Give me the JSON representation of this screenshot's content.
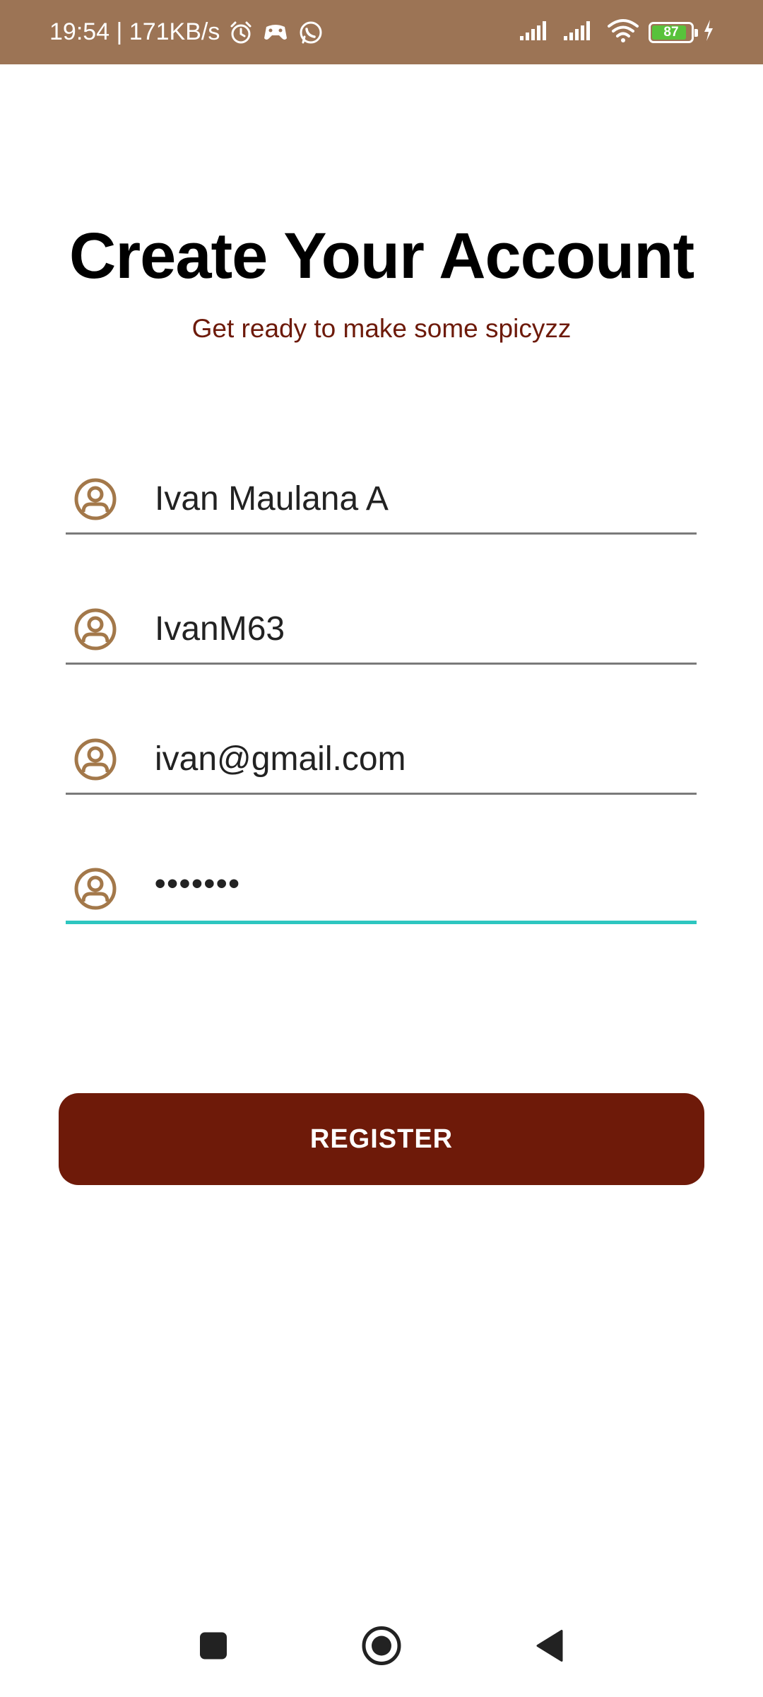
{
  "status_bar": {
    "time_and_speed": "19:54 | 171KB/s",
    "battery_percent": "87",
    "icons": [
      "alarm-icon",
      "game-icon",
      "whatsapp-icon",
      "signal-icon",
      "signal-icon",
      "wifi-icon",
      "battery-icon",
      "charging-icon"
    ],
    "background_color": "#9c7455"
  },
  "header": {
    "title": "Create Your Account",
    "subtitle": "Get ready to make some spicyzz"
  },
  "form": {
    "fields": [
      {
        "icon": "user-circle-icon",
        "value": "Ivan Maulana A"
      },
      {
        "icon": "user-circle-icon",
        "value": "IvanM63"
      },
      {
        "icon": "user-circle-icon",
        "value": "ivan@gmail.com"
      },
      {
        "icon": "user-circle-icon",
        "value": "•••••••"
      }
    ],
    "icon_color": "#a3784a",
    "focus_color": "#2dc6c0"
  },
  "register_button": {
    "label": "REGISTER",
    "color": "#6e1a09"
  },
  "nav_bar": {
    "buttons": [
      "recents-square-icon",
      "home-circle-icon",
      "back-triangle-icon"
    ]
  }
}
